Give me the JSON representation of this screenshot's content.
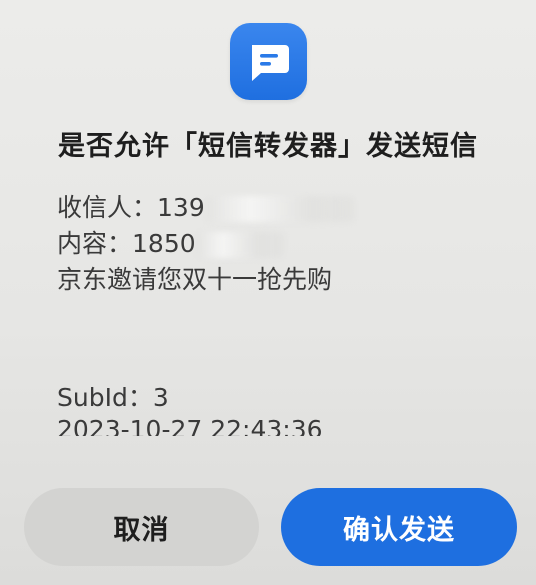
{
  "dialog": {
    "title": "是否允许「短信转发器」发送短信",
    "recipient_label": "收信人：",
    "recipient_value": "139",
    "content_label": "内容：",
    "content_value": "1850",
    "message_text": "京东邀请您双十一抢先购",
    "subid_text": "SubId：3",
    "timestamp": "2023-10-27 22:43:36",
    "cancel_label": "取消",
    "confirm_label": "确认发送"
  },
  "app_icon": {
    "icon": "message-icon",
    "color": "#1f6fe0"
  },
  "colors": {
    "accent": "#1e6fe0",
    "cancel_bg": "#d3d3d1",
    "background": "#e8e8e6"
  }
}
